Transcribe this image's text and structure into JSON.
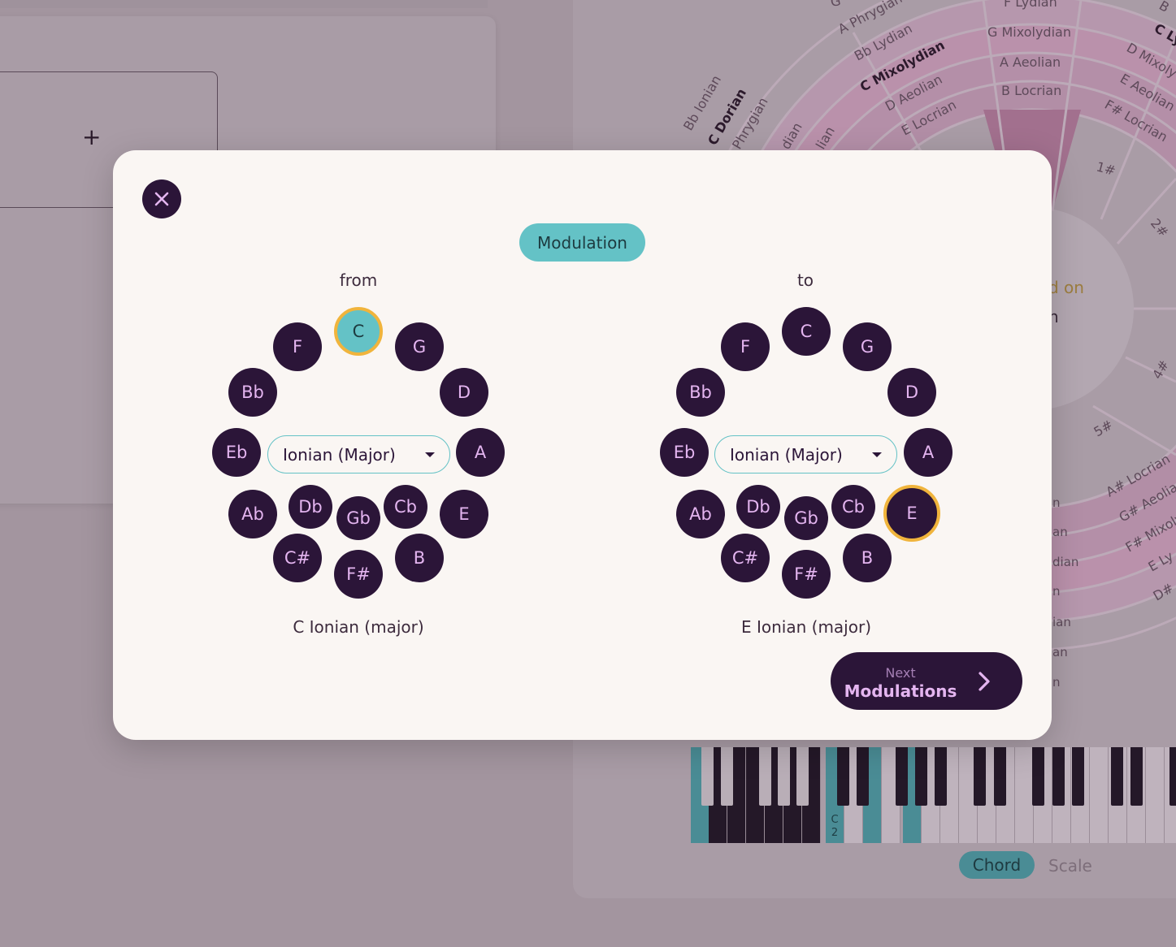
{
  "background": {
    "add_card_plus": "+",
    "wheel_labels": {
      "lydian": "F Lydian",
      "mixolydian": "G Mixolydian",
      "aeolian": "A Aeolian",
      "locrian": "B Locrian",
      "a_phrygian": "A Phrygian",
      "bb_lydian": "Bb Lydian",
      "c_mixolydian": "C Mixolydian",
      "d_aeolian": "D Aeolian",
      "e_locrian": "E Locrian",
      "bb_ionian": "Bb Ionian",
      "c_dorian": "C Dorian",
      "phrygian": "Phrygian",
      "dian": "dian",
      "lian": "lian",
      "c_ly": "C Ly",
      "d_mixoly": "D Mixoly",
      "e_aeolian": "E Aeolian",
      "fs_locrian": "F# Locrian",
      "as_locrian": "A# Locrian",
      "gs_aeolian": "G# Aeolian",
      "fs_mixoly": "F# Mixoly",
      "e_ly": "E Ly",
      "ds": "D#",
      "g_top": "G",
      "b_top": "B"
    },
    "sharps": [
      "1#",
      "2#",
      "4#",
      "5#"
    ],
    "based_on_fragment": "d on",
    "n_fragment": "n",
    "left_fragments": [
      "n",
      "an",
      "dian",
      "n",
      "ian",
      "an",
      "n"
    ],
    "piano_c2_label": "C 2",
    "toggle": {
      "chord": "Chord",
      "scale": "Scale"
    }
  },
  "modal": {
    "title": "Modulation",
    "from": {
      "label": "from",
      "notes": [
        "C",
        "G",
        "D",
        "A",
        "E",
        "B",
        "F#",
        "Gb",
        "Db",
        "C#",
        "Cb",
        "Ab",
        "Eb",
        "Bb",
        "F"
      ],
      "selected_note": "C",
      "mode": "Ionian (Major)",
      "result": "C Ionian (major)"
    },
    "to": {
      "label": "to",
      "notes": [
        "C",
        "G",
        "D",
        "A",
        "E",
        "B",
        "F#",
        "Gb",
        "Db",
        "C#",
        "Cb",
        "Ab",
        "Eb",
        "Bb",
        "F"
      ],
      "selected_note": "E",
      "mode": "Ionian (Major)",
      "result": "E Ionian (major)"
    },
    "next_button": {
      "small": "Next",
      "big": "Modulations"
    }
  },
  "colors": {
    "dark_purple": "#2b1538",
    "note_text": "#e4b5f0",
    "teal": "#64c2c6",
    "ring_gold": "#f0b43c",
    "modal_bg": "#faf6f3"
  }
}
